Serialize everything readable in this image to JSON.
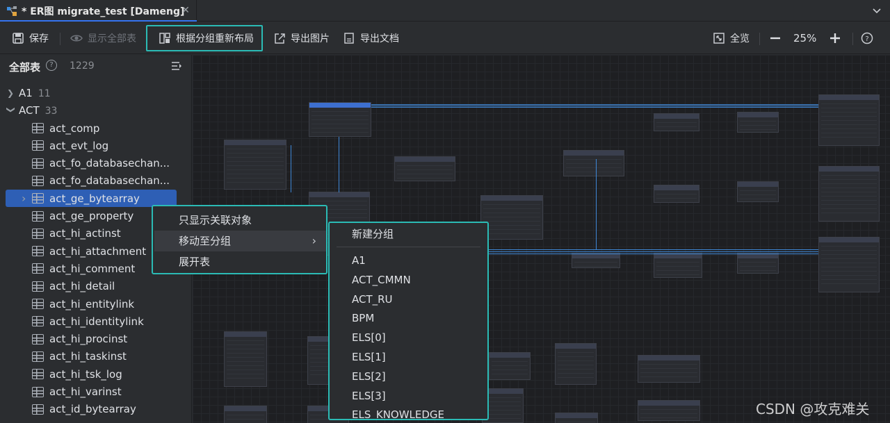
{
  "tab": {
    "title": "* ER图 migrate_test [Dameng]",
    "close_icon": "close-icon"
  },
  "toolbar": {
    "save": "保存",
    "show_all": "显示全部表",
    "relayout_by_group": "根据分组重新布局",
    "export_image": "导出图片",
    "export_doc": "导出文档",
    "overview": "全览",
    "zoom": "25%"
  },
  "sidebar": {
    "title": "全部表",
    "count": "1229",
    "groups": [
      {
        "label": "A1",
        "count": "11",
        "expanded": false
      },
      {
        "label": "ACT",
        "count": "33",
        "expanded": true
      }
    ],
    "tables": [
      "act_comp",
      "act_evt_log",
      "act_fo_databasechan...",
      "act_fo_databasechan...",
      "act_ge_bytearray",
      "act_ge_property",
      "act_hi_actinst",
      "act_hi_attachment",
      "act_hi_comment",
      "act_hi_detail",
      "act_hi_entitylink",
      "act_hi_identitylink",
      "act_hi_procinst",
      "act_hi_taskinst",
      "act_hi_tsk_log",
      "act_hi_varinst",
      "act_id_bytearray"
    ],
    "selected_table": "act_ge_bytearray"
  },
  "context_menu": {
    "items": [
      "只显示关联对象",
      "移动至分组",
      "展开表"
    ],
    "active_item": "移动至分组"
  },
  "submenu": {
    "new_group": "新建分组",
    "groups": [
      "A1",
      "ACT_CMMN",
      "ACT_RU",
      "BPM",
      "ELS[0]",
      "ELS[1]",
      "ELS[2]",
      "ELS[3]",
      "ELS_KNOWLEDGE"
    ]
  },
  "watermark": "CSDN @攻克难关",
  "colors": {
    "accent": "#2bbbb5",
    "selection": "#2e5fb5",
    "link_line": "#3f88d8"
  }
}
